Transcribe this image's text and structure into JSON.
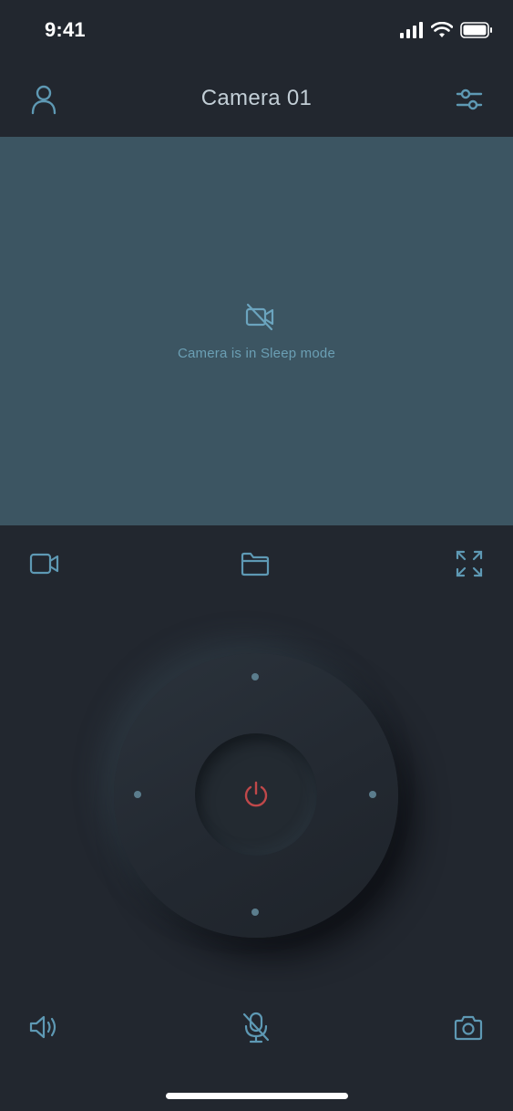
{
  "status_bar": {
    "time": "9:41",
    "icons": [
      "signal-icon",
      "wifi-icon",
      "battery-icon"
    ]
  },
  "nav": {
    "title": "Camera 01",
    "left_icon": "user-icon",
    "right_icon": "sliders-icon"
  },
  "viewer": {
    "icon": "camera-off-icon",
    "message": "Camera is in Sleep mode"
  },
  "toolbar_top": [
    "video-icon",
    "folder-icon",
    "fullscreen-icon"
  ],
  "dpad": {
    "center_icon": "power-icon",
    "directions": [
      "up",
      "right",
      "down",
      "left"
    ]
  },
  "toolbar_bottom": [
    "speaker-icon",
    "mic-off-icon",
    "camera-icon"
  ],
  "colors": {
    "background": "#22272f",
    "viewer": "#3c5562",
    "accent": "#5e99b4",
    "power": "#c0484a"
  }
}
